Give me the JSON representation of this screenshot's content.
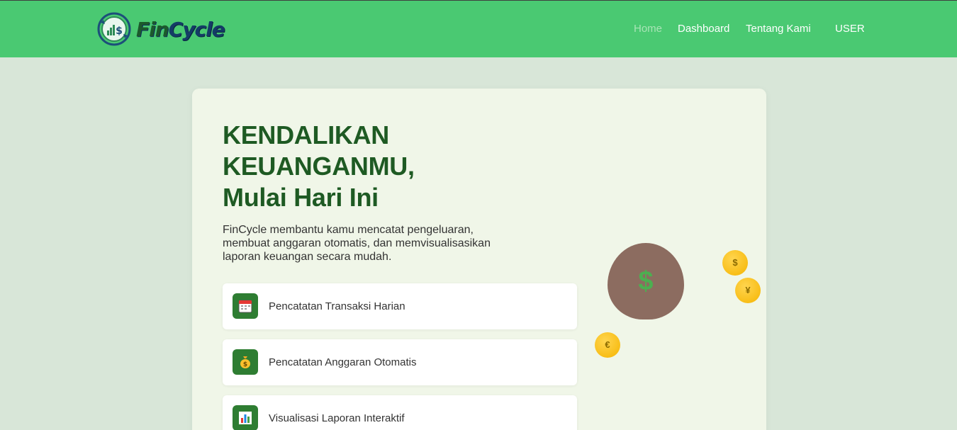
{
  "brand": {
    "name_part1": "Fin",
    "name_part2": "Cycle"
  },
  "nav": {
    "items": [
      {
        "label": "Home",
        "active": true
      },
      {
        "label": "Dashboard",
        "active": false
      },
      {
        "label": "Tentang Kami",
        "active": false
      },
      {
        "label": "USER",
        "active": false
      }
    ]
  },
  "hero": {
    "title_lines": [
      "KENDALIKAN",
      "KEUANGANMU,",
      "Mulai Hari Ini"
    ],
    "description": "FinCycle membantu kamu mencatat pengeluaran, membuat anggaran otomatis, dan memvisualisasikan laporan keuangan secara mudah."
  },
  "features": [
    {
      "label": "Pencatatan Transaksi Harian",
      "icon": "calendar-icon"
    },
    {
      "label": "Pencatatan Anggaran Otomatis",
      "icon": "money-bag-icon"
    },
    {
      "label": "Visualisasi Laporan Interaktif",
      "icon": "bar-chart-icon"
    }
  ],
  "illustration": {
    "bag_symbol": "$",
    "coins": [
      "$",
      "¥",
      "€"
    ]
  },
  "colors": {
    "navbar": "#4ac972",
    "page_bg": "#d8e6d8",
    "card_bg": "#f0f6e8",
    "title": "#1e5a23",
    "feature_icon_bg": "#2e7d32",
    "coin": "#f5b400",
    "bag": "#8c6c60"
  }
}
